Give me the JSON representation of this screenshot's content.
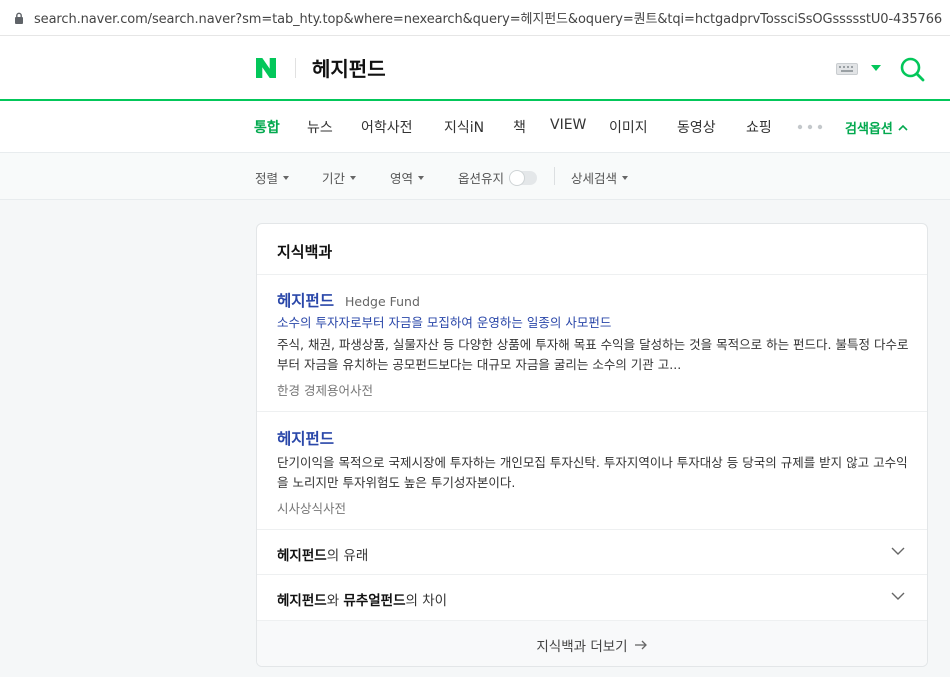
{
  "browser": {
    "url": "search.naver.com/search.naver?sm=tab_hty.top&where=nexearch&query=헤지펀드&oquery=퀀트&tqi=hctgadprvTossciSsOGssssstU0-435766"
  },
  "header": {
    "logo_letter": "N",
    "query": "헤지펀드",
    "brand_color": "#03c75a"
  },
  "tabs": {
    "items": [
      "통합",
      "뉴스",
      "어학사전",
      "지식iN",
      "책",
      "VIEW",
      "이미지",
      "동영상",
      "쇼핑"
    ],
    "active_index": 0,
    "options_label": "검색옵션"
  },
  "filters": {
    "sort_label": "정렬",
    "period_label": "기간",
    "area_label": "영역",
    "keep_option_label": "옵션유지",
    "keep_option_on": false,
    "detail_label": "상세검색"
  },
  "card": {
    "title": "지식백과",
    "entries": [
      {
        "title": "헤지펀드",
        "english": "Hedge Fund",
        "subtitle": "소수의 투자자로부터 자금을 모집하여 운영하는 일종의 사모펀드",
        "body": "주식, 채권, 파생상품, 실물자산 등 다양한 상품에 투자해 목표 수익을 달성하는 것을 목적으로 하는 펀드다. 불특정 다수로부터 자금을 유치하는 공모펀드보다는 대규모 자금을 굴리는 소수의 기관 고...",
        "source": "한경 경제용어사전"
      },
      {
        "title": "헤지펀드",
        "body": "단기이익을 목적으로 국제시장에 투자하는 개인모집 투자신탁. 투자지역이나 투자대상 등 당국의 규제를 받지 않고 고수익을 노리지만 투자위험도 높은 투기성자본이다.",
        "source": "시사상식사전"
      }
    ],
    "folds": [
      {
        "bold": "헤지펀드",
        "rest": "의 유래"
      },
      {
        "bold": "헤지펀드",
        "middle": "와 ",
        "bold2": "뮤추얼펀드",
        "rest": "의 차이"
      }
    ],
    "more_label": "지식백과 더보기"
  }
}
